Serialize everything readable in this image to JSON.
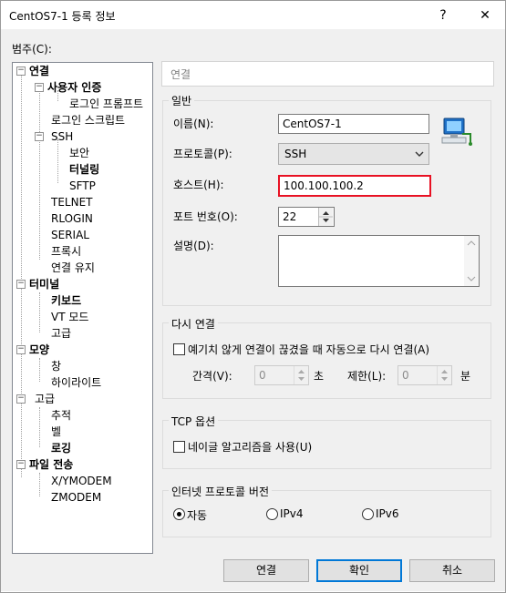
{
  "window": {
    "title": "CentOS7-1 등록 정보",
    "help_glyph": "?",
    "close_glyph": "✕"
  },
  "category_label": "범주(C):",
  "tree": {
    "items": [
      {
        "label": "연결",
        "bold": true
      },
      {
        "label": "사용자 인증",
        "bold": true
      },
      {
        "label": "로그인 프롬프트",
        "bold": false
      },
      {
        "label": "로그인 스크립트",
        "bold": false
      },
      {
        "label": "SSH",
        "bold": false
      },
      {
        "label": "보안",
        "bold": false
      },
      {
        "label": "터널링",
        "bold": true
      },
      {
        "label": "SFTP",
        "bold": false
      },
      {
        "label": "TELNET",
        "bold": false
      },
      {
        "label": "RLOGIN",
        "bold": false
      },
      {
        "label": "SERIAL",
        "bold": false
      },
      {
        "label": "프록시",
        "bold": false
      },
      {
        "label": "연결 유지",
        "bold": false
      },
      {
        "label": "터미널",
        "bold": true
      },
      {
        "label": "키보드",
        "bold": true
      },
      {
        "label": "VT 모드",
        "bold": false
      },
      {
        "label": "고급",
        "bold": false
      },
      {
        "label": "모양",
        "bold": true
      },
      {
        "label": "창",
        "bold": false
      },
      {
        "label": "하이라이트",
        "bold": false
      },
      {
        "label": "고급",
        "bold": false
      },
      {
        "label": "추적",
        "bold": false
      },
      {
        "label": "벨",
        "bold": false
      },
      {
        "label": "로깅",
        "bold": true
      },
      {
        "label": "파일 전송",
        "bold": true
      },
      {
        "label": "X/YMODEM",
        "bold": false
      },
      {
        "label": "ZMODEM",
        "bold": false
      }
    ],
    "expand_glyph": "−"
  },
  "header": {
    "text": "연결"
  },
  "general": {
    "title": "일반",
    "name_label": "이름(N):",
    "name_value": "CentOS7-1",
    "protocol_label": "프로토콜(P):",
    "protocol_value": "SSH",
    "host_label": "호스트(H):",
    "host_value": "100.100.100.2",
    "port_label": "포트 번호(O):",
    "port_value": "22",
    "desc_label": "설명(D):",
    "desc_value": ""
  },
  "reconnect": {
    "title": "다시 연결",
    "checkbox_label": "예기치 않게 연결이 끊겼을 때 자동으로 다시 연결(A)",
    "interval_label": "간격(V):",
    "interval_value": "0",
    "interval_unit": "초",
    "limit_label": "제한(L):",
    "limit_value": "0",
    "limit_unit": "분"
  },
  "tcp": {
    "title": "TCP 옵션",
    "nagle_label": "네이글 알고리즘을 사용(U)"
  },
  "ipver": {
    "title": "인터넷 프로토콜 버전",
    "options": [
      "자동",
      "IPv4",
      "IPv6"
    ],
    "selected": "자동"
  },
  "buttons": {
    "connect": "연결",
    "ok": "확인",
    "cancel": "취소"
  },
  "colors": {
    "highlight_border": "#e81123",
    "default_button_border": "#0078d7",
    "panel_bg": "#f0f0f0"
  },
  "icons": {
    "session": "network-computer-icon"
  }
}
